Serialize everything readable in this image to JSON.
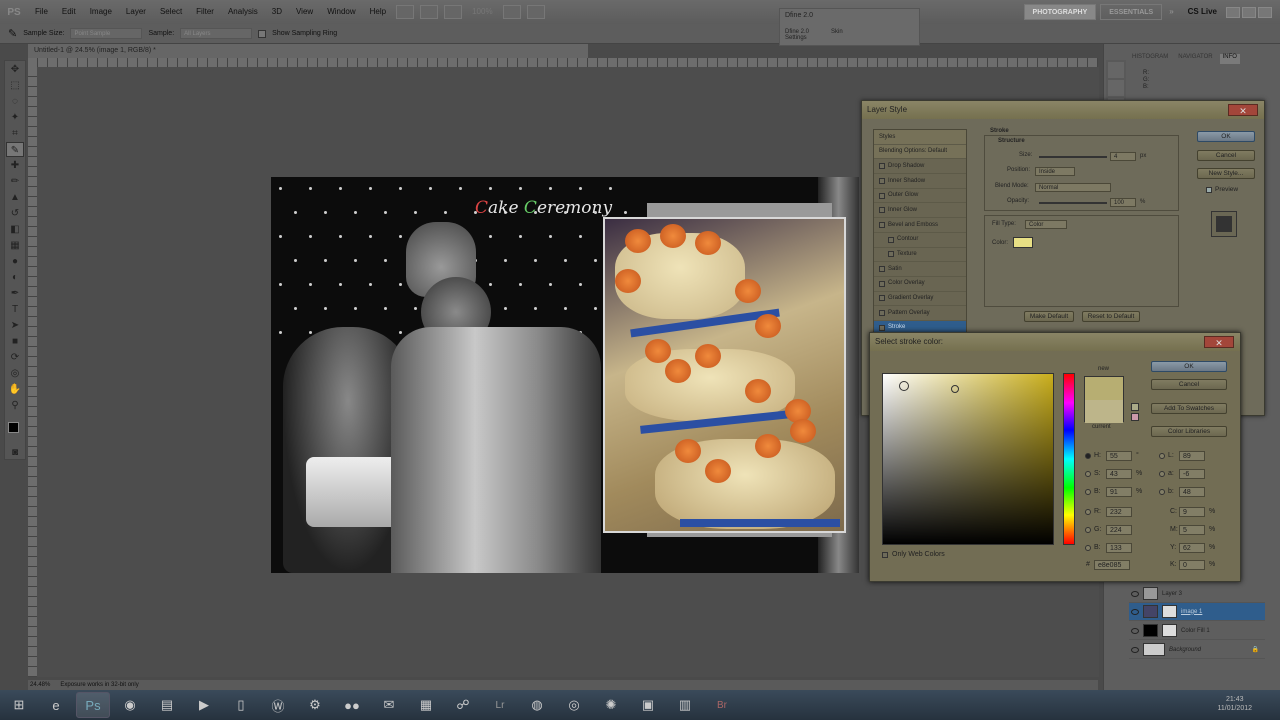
{
  "menubar": {
    "logo": "PS",
    "items": [
      "File",
      "Edit",
      "Image",
      "Layer",
      "Select",
      "Filter",
      "Analysis",
      "3D",
      "View",
      "Window",
      "Help"
    ],
    "zoom": "100%",
    "workspaces": [
      "PHOTOGRAPHY",
      "ESSENTIALS"
    ],
    "cs_live": "CS Live"
  },
  "options": {
    "sample_size_label": "Sample Size:",
    "sample_size_value": "Point Sample",
    "sample_label": "Sample:",
    "sample_value": "All Layers",
    "show_ring": "Show Sampling Ring"
  },
  "document": {
    "tab": "Untitled-1 @ 24.5% (image 1, RGB/8) *",
    "title_text_c1": "C",
    "title_text_mid1": "ake ",
    "title_text_c2": "C",
    "title_text_mid2": "eremony"
  },
  "status": {
    "zoom": "24.48%",
    "message": "Exposure works in 32-bit only"
  },
  "dfine": {
    "title": "Dfine 2.0",
    "row": "Dfine 2.0",
    "skin": "Skin",
    "settings": "Settings"
  },
  "panel": {
    "tabs": [
      "HISTOGRAM",
      "NAVIGATOR",
      "INFO"
    ],
    "info_r": "R:",
    "info_g": "G:",
    "info_b": "B:",
    "layers": [
      {
        "name": "Layer 3",
        "selected": false
      },
      {
        "name": "image 1",
        "selected": true
      },
      {
        "name": "Color Fill 1",
        "selected": false
      },
      {
        "name": "Background",
        "selected": false
      }
    ]
  },
  "layer_style": {
    "title": "Layer Style",
    "styles": [
      {
        "label": "Styles",
        "kind": "hdr"
      },
      {
        "label": "Blending Options: Default",
        "kind": "hdr"
      },
      {
        "label": "Drop Shadow",
        "kind": "chk"
      },
      {
        "label": "Inner Shadow",
        "kind": "chk"
      },
      {
        "label": "Outer Glow",
        "kind": "chk"
      },
      {
        "label": "Inner Glow",
        "kind": "chk"
      },
      {
        "label": "Bevel and Emboss",
        "kind": "chk"
      },
      {
        "label": "Contour",
        "kind": "sub"
      },
      {
        "label": "Texture",
        "kind": "sub"
      },
      {
        "label": "Satin",
        "kind": "chk"
      },
      {
        "label": "Color Overlay",
        "kind": "chk"
      },
      {
        "label": "Gradient Overlay",
        "kind": "chk"
      },
      {
        "label": "Pattern Overlay",
        "kind": "chk"
      },
      {
        "label": "Stroke",
        "kind": "sel"
      }
    ],
    "section": "Stroke",
    "structure": "Structure",
    "size_label": "Size:",
    "size_value": "4",
    "size_unit": "px",
    "position_label": "Position:",
    "position_value": "Inside",
    "blend_label": "Blend Mode:",
    "blend_value": "Normal",
    "opacity_label": "Opacity:",
    "opacity_value": "100",
    "opacity_unit": "%",
    "filltype_label": "Fill Type:",
    "filltype_value": "Color",
    "color_label": "Color:",
    "color_swatch": "#e8e085",
    "make_default": "Make Default",
    "reset_default": "Reset to Default",
    "ok": "OK",
    "cancel": "Cancel",
    "new_style": "New Style...",
    "preview": "Preview"
  },
  "picker": {
    "title": "Select stroke color:",
    "new_label": "new",
    "current_label": "current",
    "ok": "OK",
    "cancel": "Cancel",
    "add_swatches": "Add To Swatches",
    "color_libraries": "Color Libraries",
    "only_web": "Only Web Colors",
    "H": "55",
    "H_unit": "°",
    "S": "43",
    "S_unit": "%",
    "B": "91",
    "B_unit": "%",
    "R": "232",
    "G": "224",
    "Bv": "133",
    "L": "89",
    "a": "-6",
    "b": "48",
    "C": "9",
    "M": "5",
    "Y": "62",
    "K": "0",
    "pct": "%",
    "hex": "e8e085"
  },
  "taskbar": {
    "time": "21:43",
    "date": "11/01/2012"
  }
}
